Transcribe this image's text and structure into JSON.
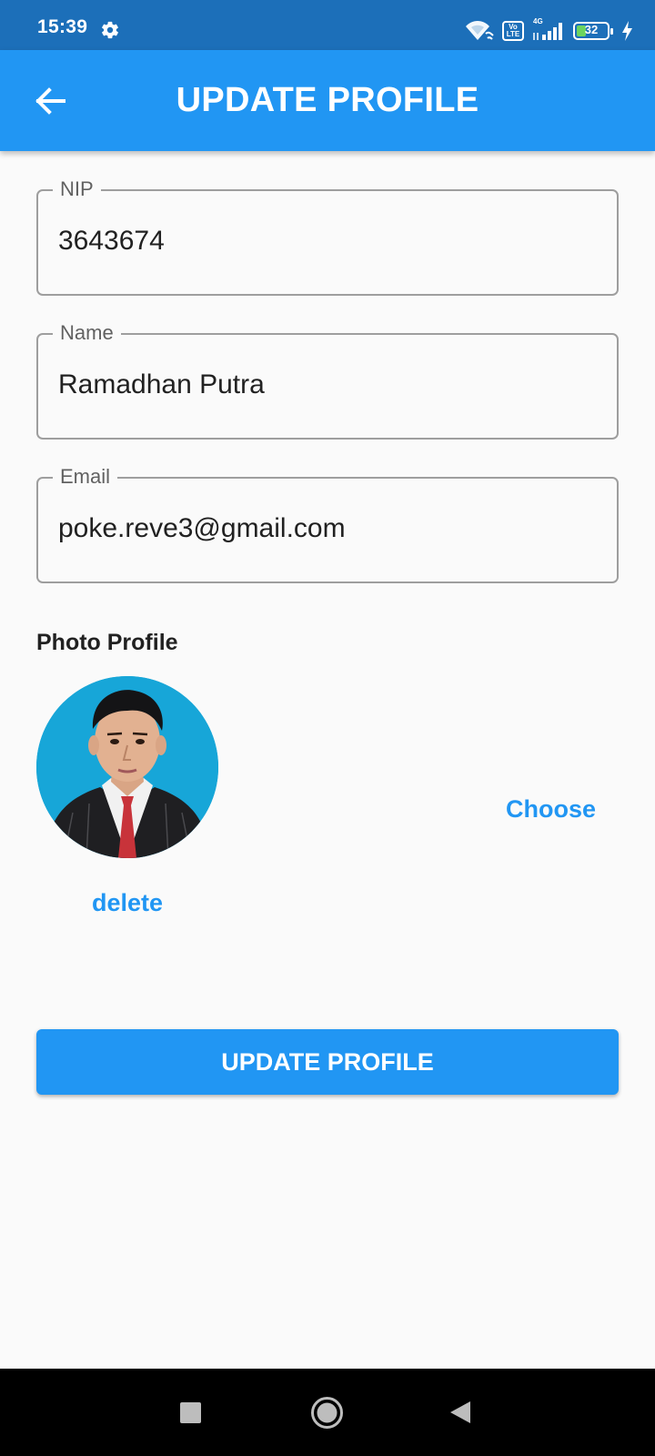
{
  "status_bar": {
    "time": "15:39",
    "volte_label": "Vo\nLTE",
    "network_label": "4G",
    "battery": "32",
    "battery_level": 0.32,
    "icons": [
      "gear-icon",
      "wifi-icon",
      "volte-icon",
      "signal-icon",
      "battery-icon",
      "charging-icon"
    ]
  },
  "app_bar": {
    "title": "UPDATE PROFILE",
    "back_icon": "arrow-left-icon"
  },
  "form": {
    "nip": {
      "label": "NIP",
      "value": "3643674"
    },
    "name": {
      "label": "Name",
      "value": "Ramadhan Putra"
    },
    "email": {
      "label": "Email",
      "value": "poke.reve3@gmail.com"
    }
  },
  "photo": {
    "title": "Photo Profile",
    "choose_label": "Choose",
    "delete_label": "delete"
  },
  "submit": {
    "label": "UPDATE PROFILE"
  },
  "nav_bar": {
    "icons": [
      "recent-apps-icon",
      "home-icon",
      "back-icon"
    ]
  },
  "colors": {
    "primary": "#2196f3",
    "status_bar": "#1c6fb9",
    "background": "#fafafa",
    "battery_fill": "#6cd45f"
  }
}
